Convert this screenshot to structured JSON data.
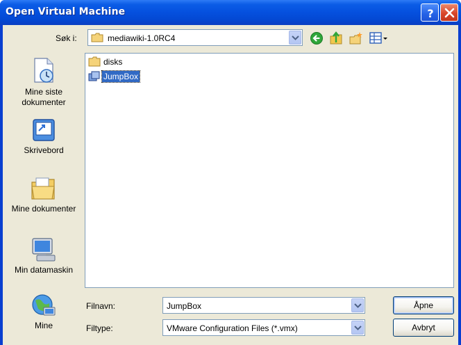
{
  "window": {
    "title": "Open Virtual Machine"
  },
  "titlebar_buttons": {
    "help": "help-icon",
    "close": "close-icon"
  },
  "lookin": {
    "label": "Søk i:",
    "value": "mediawiki-1.0RC4"
  },
  "toolbar": {
    "icons": [
      "back-icon",
      "up-folder-icon",
      "new-folder-icon",
      "view-menu-icon"
    ]
  },
  "places": [
    {
      "label": "Mine siste dokumenter",
      "icon": "recent-documents-icon"
    },
    {
      "label": "Skrivebord",
      "icon": "desktop-icon"
    },
    {
      "label": "Mine dokumenter",
      "icon": "my-documents-icon"
    },
    {
      "label": "Min datamaskin",
      "icon": "my-computer-icon"
    },
    {
      "label": "Mine",
      "icon": "network-places-icon"
    }
  ],
  "files": [
    {
      "name": "disks",
      "type": "folder",
      "selected": false
    },
    {
      "name": "JumpBox",
      "type": "vm",
      "selected": true
    }
  ],
  "filename": {
    "label": "Filnavn:",
    "value": "JumpBox"
  },
  "filetype": {
    "label": "Filtype:",
    "value": "VMware Configuration Files (*.vmx)"
  },
  "buttons": {
    "open": "Åpne",
    "cancel": "Avbryt"
  },
  "colors": {
    "titlebar": "#0550de",
    "selection": "#316ac5",
    "dialog": "#ece9d8"
  }
}
